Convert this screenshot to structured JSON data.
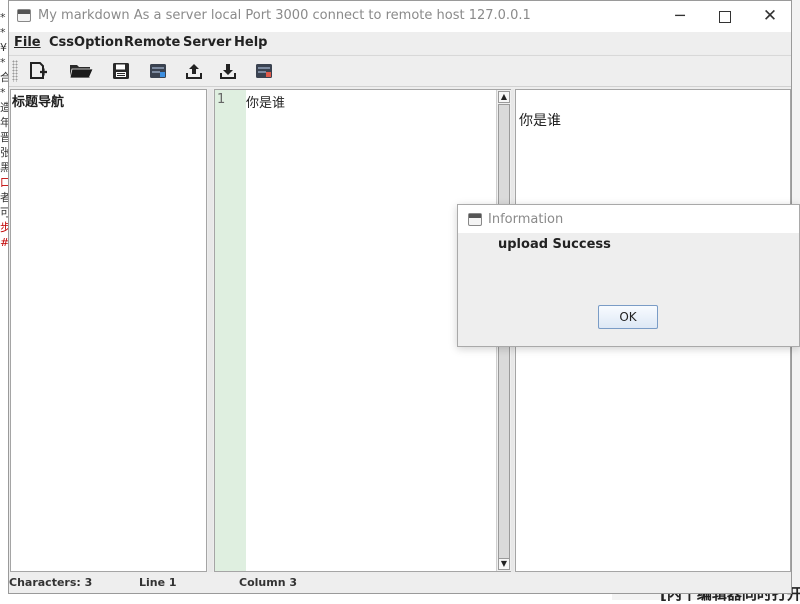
{
  "window": {
    "title": "My markdown As a server local Port 3000 connect to remote host 127.0.0.1",
    "min_glyph": "─",
    "close_glyph": "✕"
  },
  "menu": [
    {
      "label": "File"
    },
    {
      "label": "CssOption"
    },
    {
      "label": "Remote"
    },
    {
      "label": "Server"
    },
    {
      "label": "Help"
    }
  ],
  "toolbar": {
    "icons": [
      "new-file-icon",
      "open-folder-icon",
      "save-icon",
      "open-remote-icon",
      "upload-icon",
      "download-icon",
      "remote-delete-icon"
    ]
  },
  "nav": {
    "title": "标题导航"
  },
  "editor": {
    "line_number": "1",
    "content": "你是谁"
  },
  "preview": {
    "content": "你是谁"
  },
  "status": {
    "characters": "Characters: 3",
    "line": "Line 1",
    "column": "Column 3"
  },
  "dialog": {
    "title": "Information",
    "message": "upload Success",
    "ok_label": "OK"
  },
  "background": {
    "bottom_text": "[内十编辑器同时打开"
  },
  "colors": {
    "gutter": "#dfefe0",
    "ok_border": "#7a9cc6"
  }
}
